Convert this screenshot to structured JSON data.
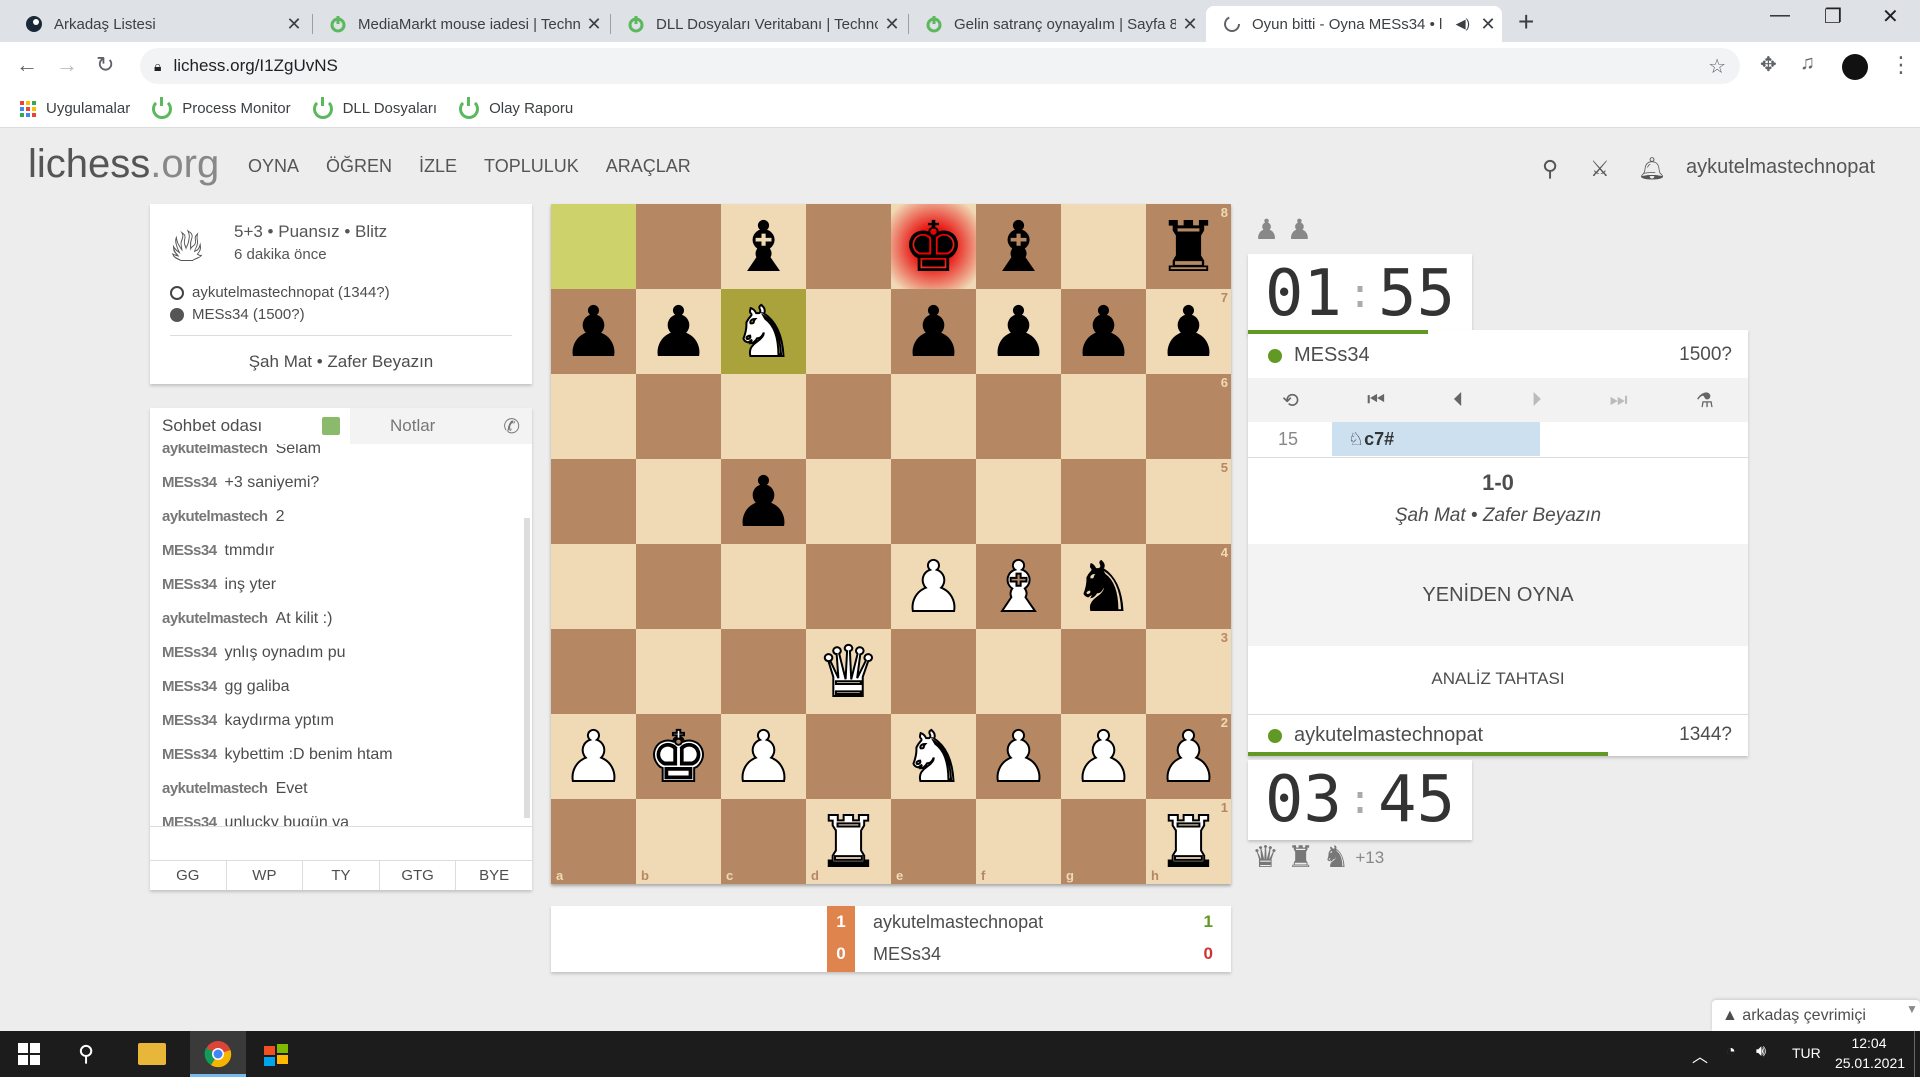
{
  "browser": {
    "tabs": [
      {
        "title": "Arkadaş Listesi",
        "icon": "steam-icon"
      },
      {
        "title": "MediaMarkt mouse iadesi | Techn",
        "icon": "technopat-icon"
      },
      {
        "title": "DLL Dosyaları Veritabanı | Technc",
        "icon": "technopat-icon"
      },
      {
        "title": "Gelin satranç oynayalım | Sayfa 8",
        "icon": "technopat-icon"
      },
      {
        "title": "Oyun bitti - Oyna MESs34 • l",
        "icon": "loading-icon"
      }
    ],
    "url": "lichess.org/I1ZgUvNS",
    "bookmarks": [
      "Uygulamalar",
      "Process Monitor",
      "DLL Dosyaları",
      "Olay Raporu"
    ]
  },
  "site": {
    "logo_main": "lichess",
    "logo_tld": ".org",
    "nav": [
      "OYNA",
      "ÖĞREN",
      "İZLE",
      "TOPLULUK",
      "ARAÇLAR"
    ],
    "username": "aykutelmastechnopat"
  },
  "game": {
    "type": "5+3 • Puansız • Blitz",
    "ago": "6 dakika önce",
    "white": "aykutelmastechnopat (1344?)",
    "black": "MESs34 (1500?)",
    "status": "Şah Mat • Zafer Beyazın"
  },
  "chat": {
    "tab_chat": "Sohbet odası",
    "tab_notes": "Notlar",
    "messages": [
      {
        "user": "aykutelmastech",
        "text": "Selam"
      },
      {
        "user": "MESs34",
        "text": "+3 saniyemi?"
      },
      {
        "user": "aykutelmastech",
        "text": "2"
      },
      {
        "user": "MESs34",
        "text": "tmmdır"
      },
      {
        "user": "MESs34",
        "text": "inş yter"
      },
      {
        "user": "aykutelmastech",
        "text": "At kilit :)"
      },
      {
        "user": "MESs34",
        "text": "ynlış oynadım pu"
      },
      {
        "user": "MESs34",
        "text": "gg galiba"
      },
      {
        "user": "MESs34",
        "text": "kaydırma yptım"
      },
      {
        "user": "MESs34",
        "text": "kybettim :D benim htam"
      },
      {
        "user": "aykutelmastech",
        "text": "Evet"
      },
      {
        "user": "MESs34",
        "text": "unlucky bugün ya"
      }
    ],
    "presets": [
      "GG",
      "WP",
      "TY",
      "GTG",
      "BYE"
    ]
  },
  "board": {
    "files": [
      "a",
      "b",
      "c",
      "d",
      "e",
      "f",
      "g",
      "h"
    ],
    "ranks": [
      "8",
      "7",
      "6",
      "5",
      "4",
      "3",
      "2",
      "1"
    ],
    "pieces": [
      [
        "",
        "",
        "b",
        "",
        "k",
        "b",
        "",
        "r"
      ],
      [
        "p",
        "p",
        "N",
        "",
        "p",
        "p",
        "p",
        "p"
      ],
      [
        "",
        "",
        "",
        "",
        "",
        "",
        "",
        ""
      ],
      [
        "",
        "",
        "p",
        "",
        "",
        "",
        "",
        ""
      ],
      [
        "",
        "",
        "",
        "",
        "P",
        "B",
        "n",
        ""
      ],
      [
        "",
        "",
        "",
        "Q",
        "",
        "",
        "",
        ""
      ],
      [
        "P",
        "K",
        "P",
        "",
        "N",
        "P",
        "P",
        "P"
      ],
      [
        "",
        "",
        "",
        "R",
        "",
        "",
        "",
        "R"
      ]
    ]
  },
  "crosstable": {
    "rows": [
      {
        "score": "1",
        "name": "aykutelmastechnopat",
        "result": "1"
      },
      {
        "score": "0",
        "name": "MESs34",
        "result": "0"
      }
    ]
  },
  "panel": {
    "top_captured": "♟ ♟",
    "top_clock": "01:55",
    "top_clock_min": "01",
    "top_clock_sec": "55",
    "top_player": "MESs34",
    "top_rating": "1500?",
    "top_clock_fraction": 0.36,
    "move_no": "15",
    "move": "♘c7#",
    "result": "1-0",
    "result_text": "Şah Mat • Zafer Beyazın",
    "rematch": "YENİDEN OYNA",
    "analysis": "ANALİZ TAHTASI",
    "bottom_player": "aykutelmastechnopat",
    "bottom_rating": "1344?",
    "bottom_clock_min": "03",
    "bottom_clock_sec": "45",
    "bottom_clock_fraction": 0.72,
    "bottom_captured": "♛ ♜ ♞",
    "bottom_diff": "+13"
  },
  "footer": {
    "friends": "arkadaş çevrimiçi"
  },
  "taskbar": {
    "lang": "TUR",
    "time": "12:04",
    "date": "25.01.2021"
  }
}
